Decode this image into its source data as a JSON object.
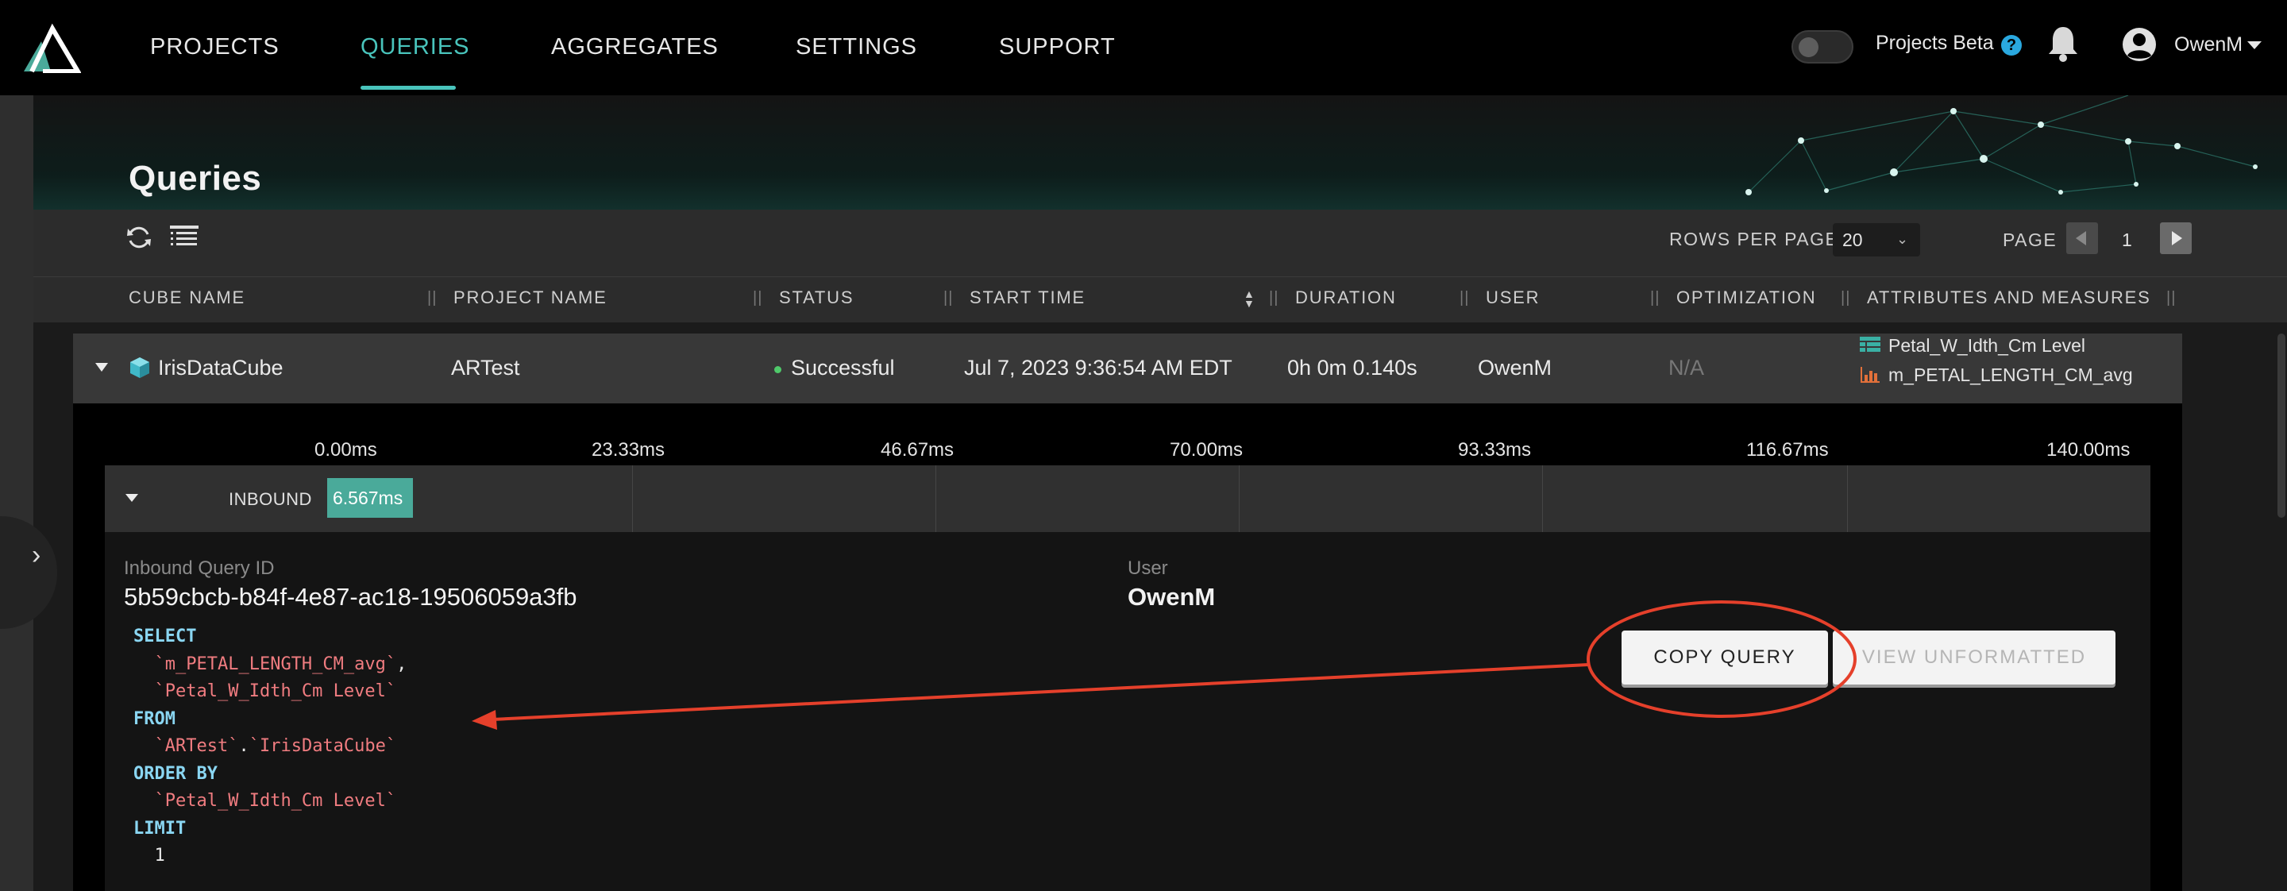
{
  "nav": {
    "items": [
      {
        "label": "PROJECTS"
      },
      {
        "label": "QUERIES"
      },
      {
        "label": "AGGREGATES"
      },
      {
        "label": "SETTINGS"
      },
      {
        "label": "SUPPORT"
      }
    ],
    "active": "QUERIES",
    "beta_label": "Projects Beta",
    "help_symbol": "?",
    "user_name": "OwenM"
  },
  "page": {
    "title": "Queries"
  },
  "toolbar": {
    "rows_per_page_label": "ROWS PER PAGE",
    "rows_per_page_value": "20",
    "page_label": "PAGE",
    "page_number": "1"
  },
  "columns": [
    {
      "label": "CUBE NAME"
    },
    {
      "label": "PROJECT NAME"
    },
    {
      "label": "STATUS"
    },
    {
      "label": "START TIME"
    },
    {
      "label": "DURATION"
    },
    {
      "label": "USER"
    },
    {
      "label": "OPTIMIZATION"
    },
    {
      "label": "ATTRIBUTES AND MEASURES"
    }
  ],
  "column_separator": "||",
  "row": {
    "cube_name": "IrisDataCube",
    "project_name": "ARTest",
    "status": "Successful",
    "start_time": "Jul 7, 2023 9:36:54 AM EDT",
    "duration": "0h 0m 0.140s",
    "user": "OwenM",
    "optimization": "N/A",
    "attributes": [
      "Petal_W_Idth_Cm Level",
      "m_PETAL_LENGTH_CM_avg"
    ]
  },
  "timeline": {
    "ticks": [
      "0.00ms",
      "23.33ms",
      "46.67ms",
      "70.00ms",
      "93.33ms",
      "116.67ms",
      "140.00ms"
    ],
    "label": "INBOUND",
    "bar_value": "6.567ms",
    "bar_fraction": 0.047
  },
  "detail": {
    "query_id_label": "Inbound Query ID",
    "query_id": "5b59cbcb-b84f-4e87-ac18-19506059a3fb",
    "user_label": "User",
    "user": "OwenM",
    "copy_button": "COPY QUERY",
    "view_button": "VIEW UNFORMATTED"
  },
  "sql": {
    "select": "SELECT",
    "col1": "`m_PETAL_LENGTH_CM_avg`",
    "comma": ",",
    "col2": "`Petal_W_Idth_Cm Level`",
    "from": "FROM",
    "schema": "`ARTest`",
    "dot": ".",
    "table": "`IrisDataCube`",
    "order_by": "ORDER BY",
    "order_col": "`Petal_W_Idth_Cm Level`",
    "limit": "LIMIT",
    "limit_value": "1"
  },
  "colors": {
    "accent": "#49c4bc",
    "success": "#4fc96a",
    "annotation": "#e5402b",
    "sql_keyword": "#8ad6f2",
    "sql_identifier": "#f07c80"
  }
}
